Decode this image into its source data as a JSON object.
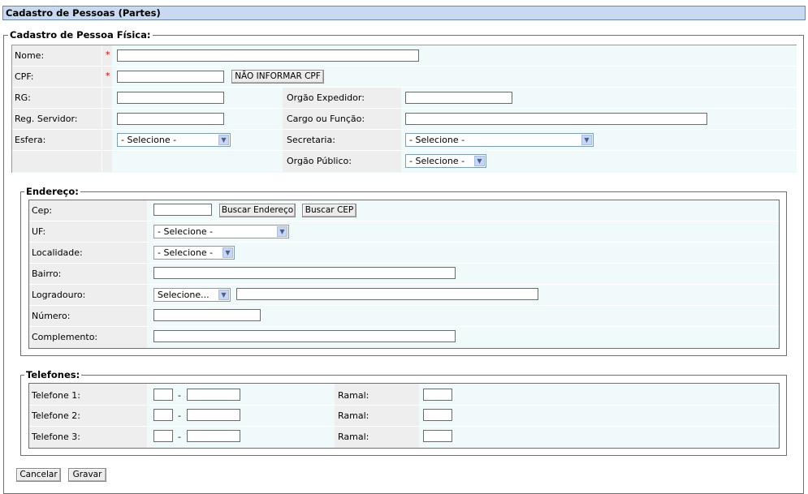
{
  "page": {
    "title": "Cadastro de Pessoas (Partes)"
  },
  "pessoa": {
    "legend": "Cadastro de Pessoa Física:",
    "required_mark": "*",
    "nome_label": "Nome:",
    "nome_value": "",
    "cpf_label": "CPF:",
    "cpf_value": "",
    "nao_informar_cpf": "NÃO INFORMAR CPF",
    "rg_label": "RG:",
    "orgao_expedidor_label": "Orgão Expedidor:",
    "reg_servidor_label": "Reg. Servidor:",
    "cargo_label": "Cargo ou Função:",
    "esfera_label": "Esfera:",
    "esfera_value": "- Selecione -",
    "secretaria_label": "Secretaria:",
    "secretaria_value": "- Selecione -",
    "orgao_publico_label": "Orgão Público:",
    "orgao_publico_value": "- Selecione -"
  },
  "endereco": {
    "legend": "Endereço:",
    "cep_label": "Cep:",
    "buscar_endereco": "Buscar Endereço",
    "buscar_cep": "Buscar CEP",
    "uf_label": "UF:",
    "uf_value": "- Selecione -",
    "localidade_label": "Localidade:",
    "localidade_value": "- Selecione -",
    "bairro_label": "Bairro:",
    "logradouro_label": "Logradouro:",
    "logradouro_tipo_value": "Selecione...",
    "numero_label": "Número:",
    "complemento_label": "Complemento:"
  },
  "telefones": {
    "legend": "Telefones:",
    "separator": "-",
    "ramal_label": "Ramal:",
    "rows": [
      {
        "label": "Telefone 1:"
      },
      {
        "label": "Telefone 2:"
      },
      {
        "label": "Telefone 3:"
      }
    ]
  },
  "actions": {
    "cancelar": "Cancelar",
    "gravar": "Gravar"
  },
  "colors": {
    "title_bg": "#c8daf2",
    "panel_bg": "#f1fafa",
    "label_bg": "#eeeeee",
    "required": "#d00000"
  }
}
